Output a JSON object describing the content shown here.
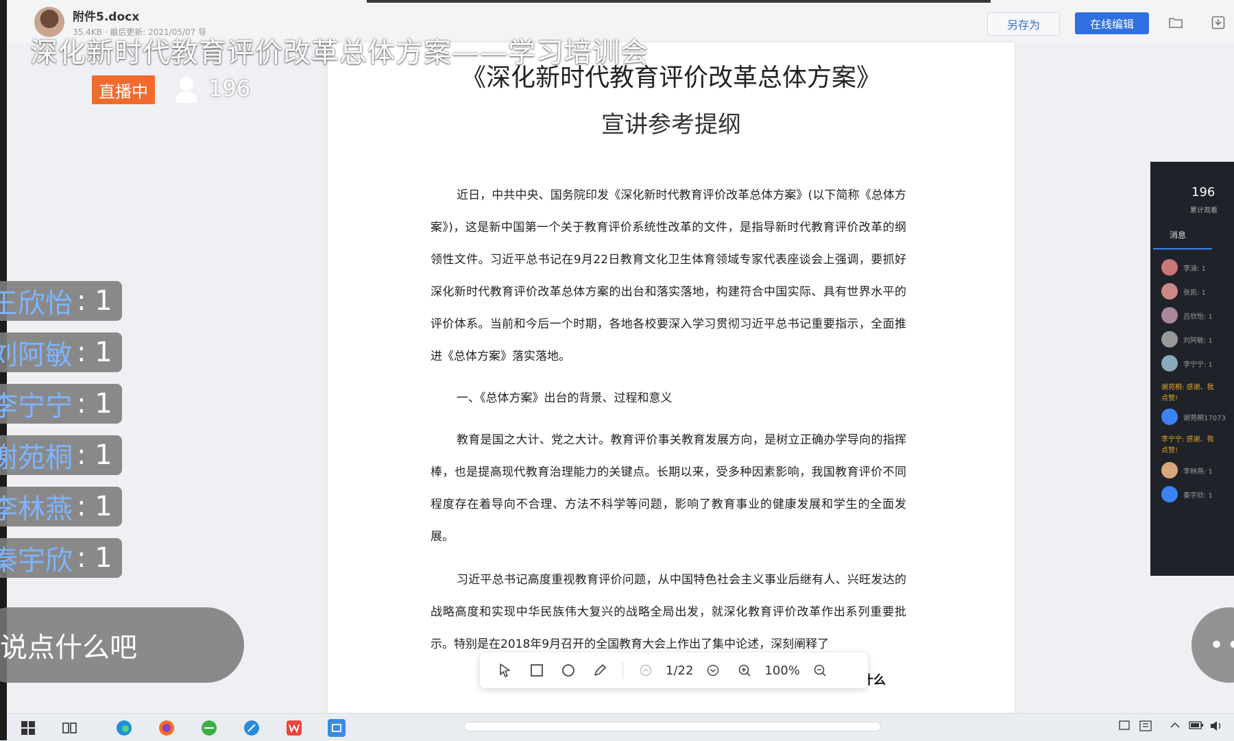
{
  "document": {
    "filename": "附件5.docx",
    "filemeta": "35.4KB · 最后更新: 2021/05/07 导",
    "title_line1": "《深化新时代教育评价改革总体方案》",
    "title_line2": "宣讲参考提纲",
    "paragraphs": [
      "近日，中共中央、国务院印发《深化新时代教育评价改革总体方案》(以下简称《总体方案》)，这是新中国第一个关于教育评价系统性改革的文件，是指导新时代教育评价改革的纲领性文件。习近平总书记在9月22日教育文化卫生体育领域专家代表座谈会上强调，要抓好深化新时代教育评价改革总体方案的出台和落实落地，构建符合中国实际、具有世界水平的评价体系。当前和今后一个时期，各地各校要深入学习贯彻习近平总书记重要指示，全面推进《总体方案》落实落地。"
    ],
    "heading1": "一、《总体方案》出台的背景、过程和意义",
    "paragraph2": "教育是国之大计、党之大计。教育评价事关教育发展方向，是树立正确办学导向的指挥棒，也是提高现代教育治理能力的关键点。长期以来，受多种因素影响，我国教育评价不同程度存在着导向不合理、方法不科学等问题，影响了教育事业的健康发展和学生的全面发展。",
    "paragraph3": "习近平总书记高度重视教育评价问题，从中国特色社会主义事业后继有人、兴旺发达的战略高度和实现中华民族伟大复兴的战略全局出发，就深化教育评价改革作出系列重要批示。特别是在2018年9月召开的全国教育大会上作出了集中论述，深刻阐释了",
    "tail_text": "什么"
  },
  "toolbar": {
    "save_as_label": "另存为",
    "online_edit_label": "在线编辑",
    "page_indicator": "1/22",
    "zoom_level": "100%"
  },
  "live": {
    "title": "深化新时代教育评价改革总体方案——学习培训会",
    "status_badge": "直播中",
    "viewer_count": "196",
    "comment_placeholder": "说点什么吧",
    "more_label": "••",
    "gifts": [
      {
        "name": "王欣怡",
        "count": ": 1"
      },
      {
        "name": "刘阿敏",
        "count": ": 1"
      },
      {
        "name": "李宁宁",
        "count": ": 1"
      },
      {
        "name": "谢苑桐",
        "count": ": 1"
      },
      {
        "name": "李林燕",
        "count": ": 1"
      },
      {
        "name": "秦宇欣",
        "count": ": 1"
      }
    ]
  },
  "side_panel": {
    "count": "196",
    "sub_label": "累计观看",
    "tab_label": "消息",
    "rows": [
      {
        "name": "李涵: 1"
      },
      {
        "name": "张凯: 1"
      },
      {
        "name": "吕欣怡: 1"
      },
      {
        "name": "刘阿敏: 1"
      },
      {
        "name": "李宁宁: 1"
      }
    ],
    "note1": "谢苑桐: 感谢、我",
    "note2": "点赞!",
    "rows2": [
      {
        "name": "谢苑桐17073"
      },
      {
        "name": "李林燕: 1"
      },
      {
        "name": "秦宇欣: 1"
      }
    ],
    "note3": "李宁宁: 感谢、我",
    "note4": "点赞!"
  },
  "colors": {
    "live_badge": "#f26a2e",
    "edit_button": "#2f6fe0",
    "gift_name": "#7eb4ff"
  }
}
